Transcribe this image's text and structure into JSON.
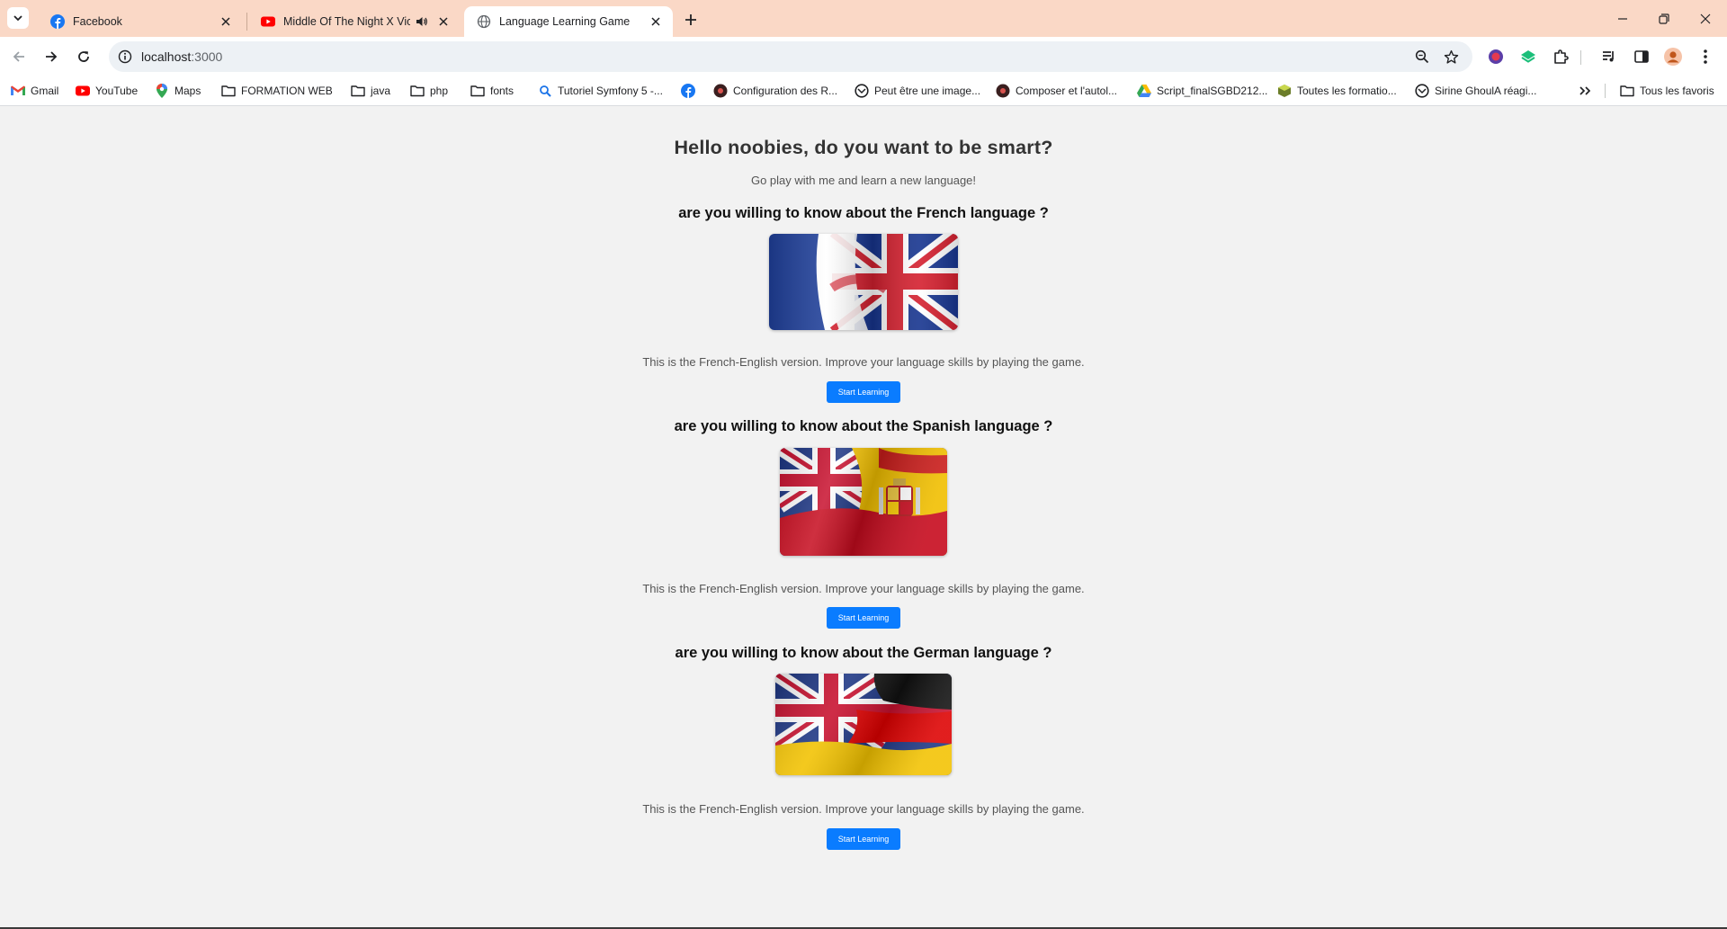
{
  "browser": {
    "tabs": [
      {
        "title": "Facebook",
        "icon": "facebook-icon",
        "active": false
      },
      {
        "title": "Middle Of The Night X Violin",
        "icon": "youtube-icon",
        "active": false,
        "audio": true
      },
      {
        "title": "Language Learning Game",
        "icon": "globe-icon",
        "active": true
      }
    ],
    "url_host": "localhost",
    "url_port": ":3000",
    "bookmarks": [
      {
        "label": "Gmail",
        "icon": "gmail-icon"
      },
      {
        "label": "YouTube",
        "icon": "youtube-icon"
      },
      {
        "label": "Maps",
        "icon": "maps-pin-icon"
      },
      {
        "label": "FORMATION WEB",
        "icon": "folder-icon"
      },
      {
        "label": "java",
        "icon": "folder-icon"
      },
      {
        "label": "php",
        "icon": "folder-icon"
      },
      {
        "label": "fonts",
        "icon": "folder-icon"
      },
      {
        "label": "Tutoriel Symfony 5 -...",
        "icon": "search-bookmark-icon"
      },
      {
        "label": "",
        "icon": "facebook-icon"
      },
      {
        "label": "Configuration des R...",
        "icon": "site-icon"
      },
      {
        "label": "Peut être une image...",
        "icon": "site-icon"
      },
      {
        "label": "Composer et l'autol...",
        "icon": "site-icon"
      },
      {
        "label": "Script_finalSGBD212...",
        "icon": "drive-icon"
      },
      {
        "label": "Toutes les formatio...",
        "icon": "site-icon"
      },
      {
        "label": "Sirine GhoulA réagi...",
        "icon": "site-icon"
      }
    ],
    "all_bookmarks": "Tous les favoris",
    "colors": {
      "tabstrip": "#fad8c6",
      "accent": "#0a7cff"
    }
  },
  "page": {
    "title": "Hello noobies, do you want to be smart?",
    "subtitle": "Go play with me and learn a new language!",
    "sections": [
      {
        "question": "are you willing to know about the French language ?",
        "flag": "french-english-flag",
        "description": "This is the French-English version. Improve your language skills by playing the game.",
        "button": "Start Learning"
      },
      {
        "question": "are you willing to know about the Spanish language ?",
        "flag": "english-spanish-flag",
        "description": "This is the French-English version. Improve your language skills by playing the game.",
        "button": "Start Learning"
      },
      {
        "question": "are you willing to know about the German language ?",
        "flag": "english-german-flag",
        "description": "This is the French-English version. Improve your language skills by playing the game.",
        "button": "Start Learning"
      }
    ]
  }
}
